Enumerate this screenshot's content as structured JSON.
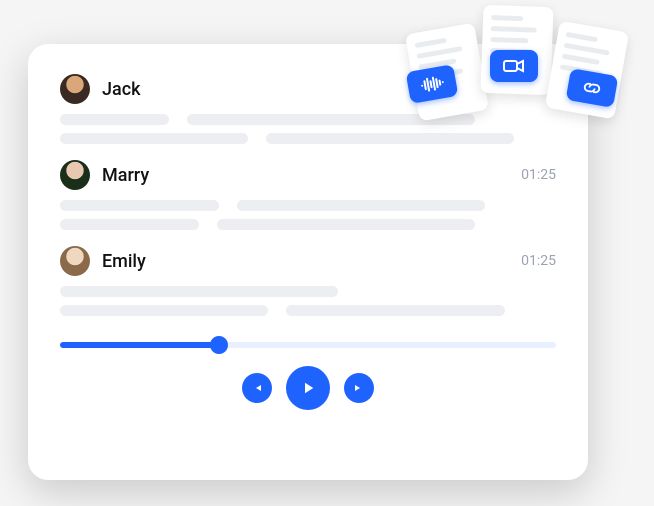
{
  "speakers": [
    {
      "name": "Jack",
      "time": ""
    },
    {
      "name": "Marry",
      "time": "01:25"
    },
    {
      "name": "Emily",
      "time": "01:25"
    }
  ],
  "playback": {
    "progress_percent": 32
  },
  "badges": {
    "audio": "audio-waveform-icon",
    "video": "video-camera-icon",
    "link": "link-icon"
  }
}
